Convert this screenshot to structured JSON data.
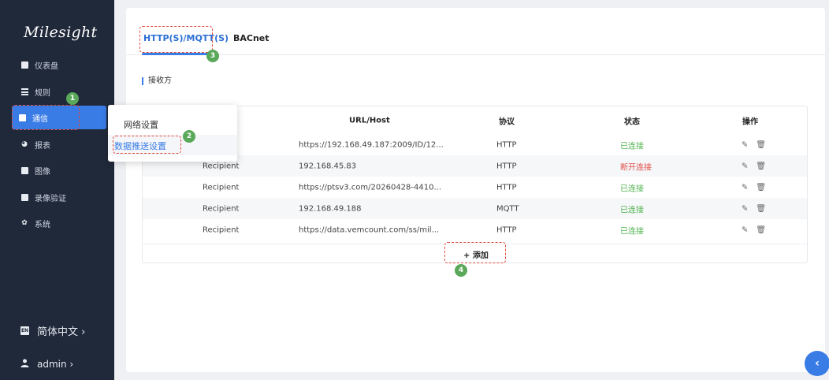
{
  "app": {
    "logo": "Milesight"
  },
  "sidebar": {
    "items": [
      {
        "label": "仪表盘",
        "icon": "dashboard-icon"
      },
      {
        "label": "规则",
        "icon": "rules-icon"
      },
      {
        "label": "通信",
        "icon": "communication-icon"
      },
      {
        "label": "报表",
        "icon": "report-pie-icon"
      },
      {
        "label": "图像",
        "icon": "image-icon"
      },
      {
        "label": "录像验证",
        "icon": "video-verify-icon"
      },
      {
        "label": "系统",
        "icon": "gear-icon"
      }
    ],
    "language": {
      "badge": "EN",
      "label": "简体中文 ›"
    },
    "user": {
      "label": "admin  ›"
    }
  },
  "flyout": {
    "items": [
      "网络设置",
      "数据推送设置"
    ]
  },
  "tabs": [
    "HTTP(S)/MQTT(S)",
    "BACnet"
  ],
  "section": {
    "title": "接收方"
  },
  "table": {
    "headers": {
      "url": "URL/Host",
      "protocol": "协议",
      "status": "状态",
      "ops": "操作"
    },
    "rows": [
      {
        "name": "",
        "url": "https://192.168.49.187:2009/ID/12...",
        "protocol": "HTTP",
        "status": "已连接",
        "ok": true
      },
      {
        "name": "Recipient",
        "url": "192.168.45.83",
        "protocol": "HTTP",
        "status": "断开连接",
        "ok": false
      },
      {
        "name": "Recipient",
        "url": "https://ptsv3.com/20260428-4410...",
        "protocol": "HTTP",
        "status": "已连接",
        "ok": true
      },
      {
        "name": "Recipient",
        "url": "192.168.49.188",
        "protocol": "MQTT",
        "status": "已连接",
        "ok": true
      },
      {
        "name": "Recipient",
        "url": "https://data.vemcount.com/ss/mil...",
        "protocol": "HTTP",
        "status": "已连接",
        "ok": true
      }
    ],
    "add_label": "+ 添加"
  },
  "annotations": [
    "1",
    "2",
    "3",
    "4"
  ],
  "colors": {
    "accent": "#3a7ce6",
    "sidebar": "#20293a",
    "ok": "#52b552",
    "error": "#e0504a",
    "annotation": "#e04b3c"
  }
}
